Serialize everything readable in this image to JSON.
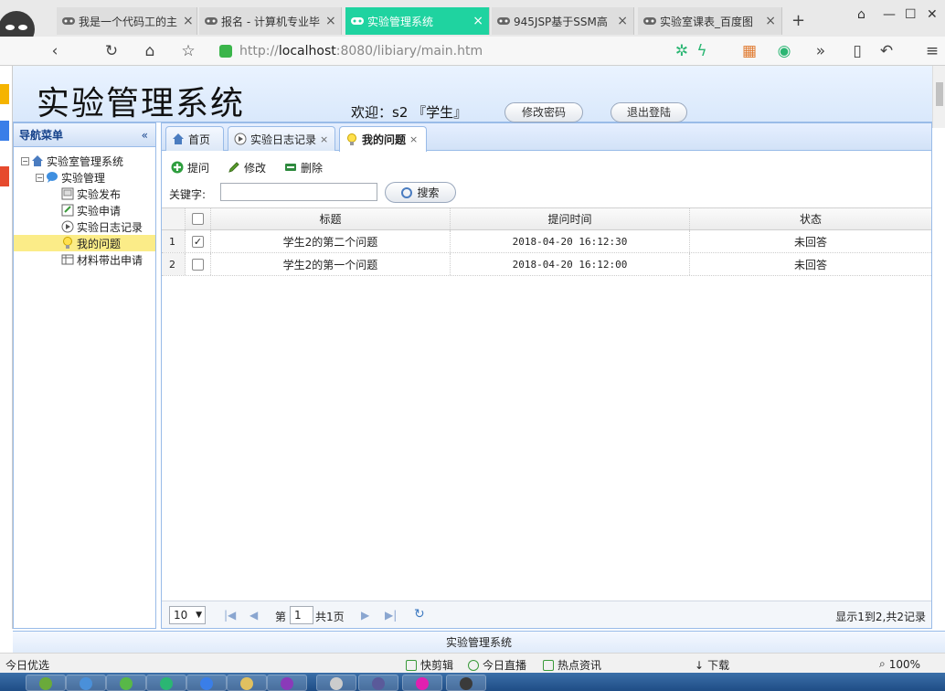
{
  "browser": {
    "tabs": [
      {
        "label": "我是一个代码工的主"
      },
      {
        "label": "报名 - 计算机专业毕"
      },
      {
        "label": "实验管理系统"
      },
      {
        "label": "945JSP基于SSM高"
      },
      {
        "label": "实验室课表_百度图"
      }
    ],
    "url_prefix": "http://",
    "url_host": "localhost",
    "url_rest": ":8080/libiary/main.htm"
  },
  "header": {
    "title": "实验管理系统",
    "welcome": "欢迎：s2 『学生』",
    "change_password": "修改密码",
    "logout": "退出登陆"
  },
  "nav": {
    "title": "导航菜单",
    "root": "实验室管理系统",
    "group": "实验管理",
    "items": [
      "实验发布",
      "实验申请",
      "实验日志记录",
      "我的问题",
      "材料带出申请"
    ]
  },
  "center": {
    "tabs": [
      "首页",
      "实验日志记录",
      "我的问题"
    ],
    "toolbar": {
      "ask": "提问",
      "edit": "修改",
      "delete": "删除"
    },
    "keyword_label": "关键字:",
    "keyword_value": "",
    "search": "搜索",
    "columns": [
      "标题",
      "提问时间",
      "状态"
    ],
    "rows": [
      {
        "num": "1",
        "checked": true,
        "title": "学生2的第二个问题",
        "time": "2018-04-20 16:12:30",
        "status": "未回答"
      },
      {
        "num": "2",
        "checked": false,
        "title": "学生2的第一个问题",
        "time": "2018-04-20 16:12:00",
        "status": "未回答"
      }
    ],
    "pager": {
      "page_size": "10",
      "page_label": "第",
      "page_value": "1",
      "page_total": "共1页",
      "info": "显示1到2,共2记录"
    }
  },
  "footer": {
    "text": "实验管理系统"
  },
  "statusbar": {
    "left": "今日优选",
    "items": [
      "快剪辑",
      "今日直播",
      "热点资讯",
      "下载"
    ],
    "zoom": "100%"
  },
  "colors": {
    "active_tab": "#1fd3a0",
    "panel_border": "#99bbe8",
    "selected_row": "#fbec88"
  }
}
